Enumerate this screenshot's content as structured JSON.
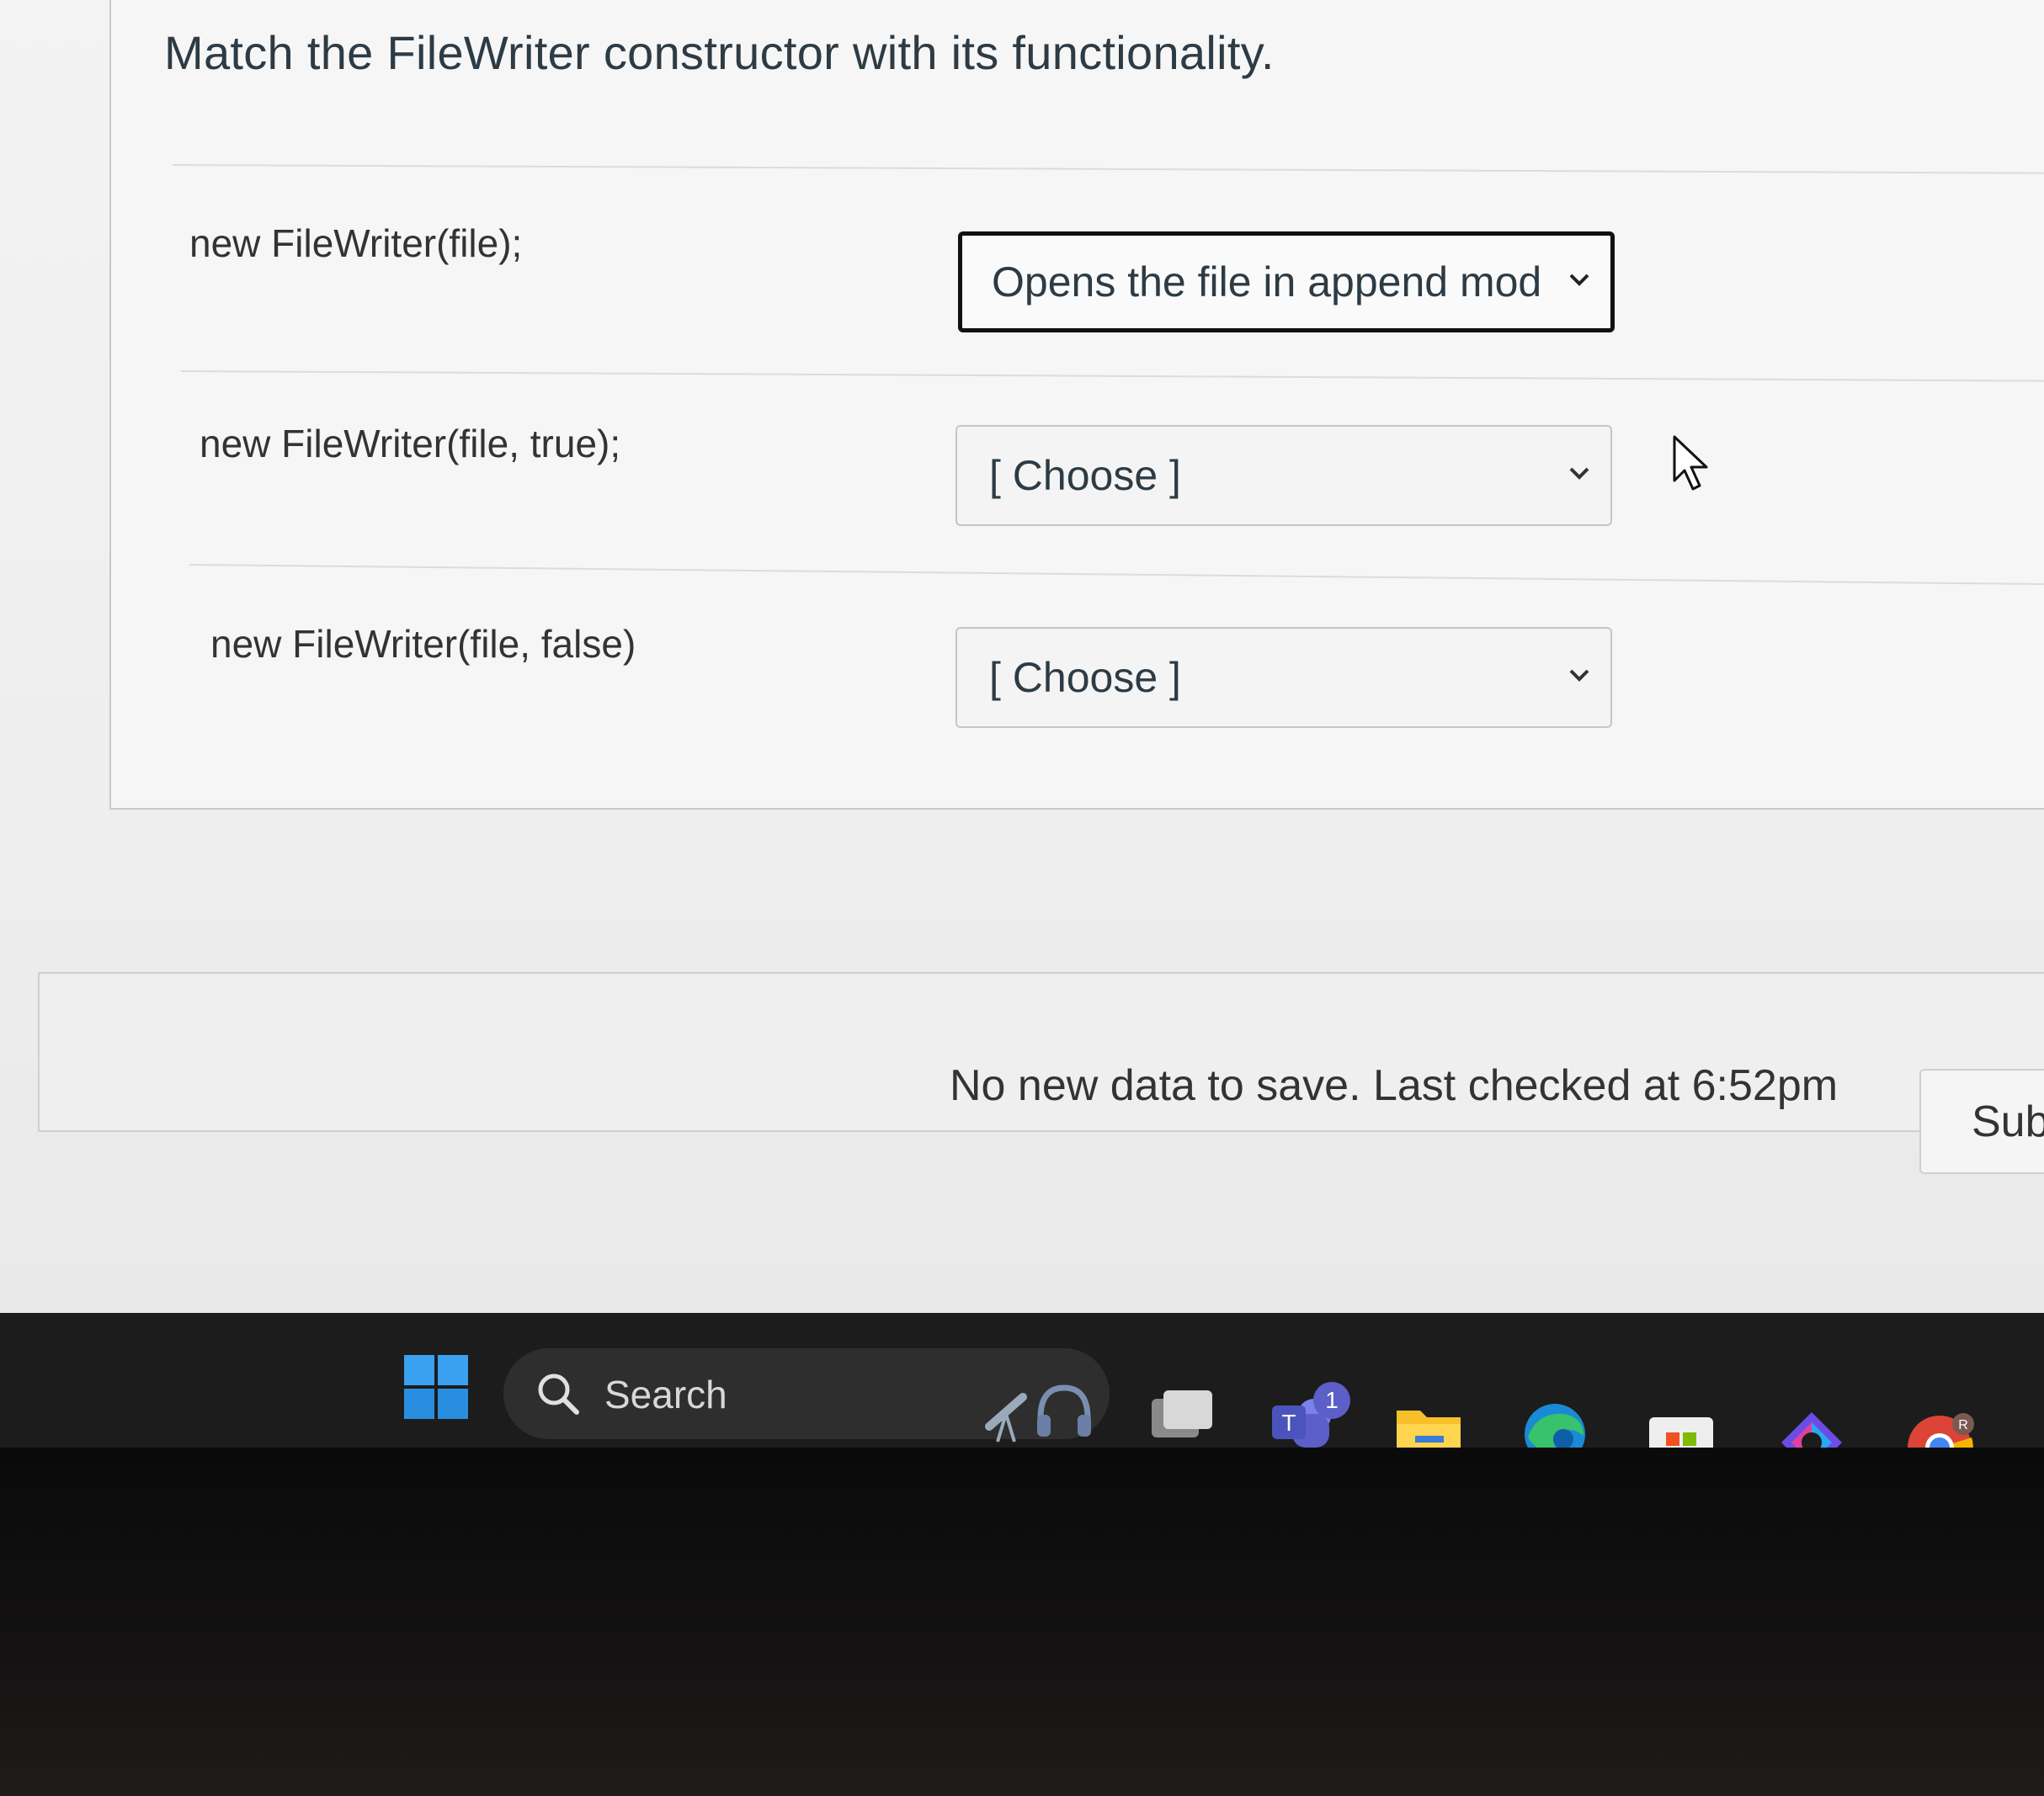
{
  "question": {
    "text": "Match the FileWriter constructor with its functionality."
  },
  "matches": [
    {
      "prompt": "new FileWriter(file);",
      "selected": "Opens the file in append mod"
    },
    {
      "prompt": "new FileWriter(file, true);",
      "selected": "[ Choose ]"
    },
    {
      "prompt": "new FileWriter(file, false)",
      "selected": "[ Choose ]"
    }
  ],
  "footer": {
    "save_status": "No new data to save. Last checked at 6:52pm",
    "submit_label": "Sub"
  },
  "taskbar": {
    "search_label": "Search",
    "teams_badge_count": "1",
    "chrome_profile_letter": "R"
  },
  "colors": {
    "text": "#2d3b45",
    "taskbar": "#1c1c1c",
    "accent": "#4c9be8"
  }
}
